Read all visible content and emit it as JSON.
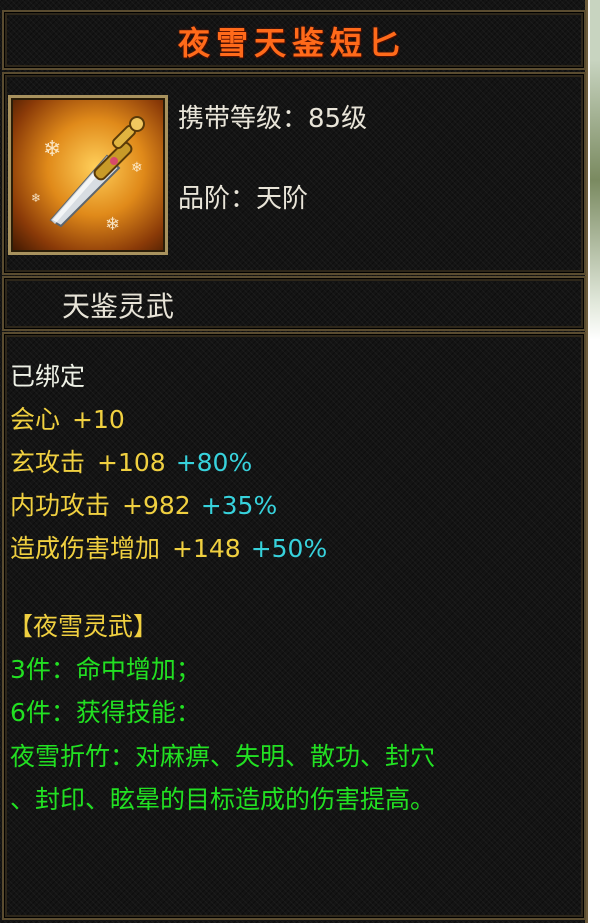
{
  "item": {
    "name": "夜雪天鉴短匕",
    "level_line": "携带等级：85级",
    "grade_line": "品阶：天阶",
    "category": "天鉴灵武",
    "icon": "dagger-icon"
  },
  "stats": {
    "bound": "已绑定",
    "crit": {
      "label": "会心",
      "value": "+10"
    },
    "xuan_attack": {
      "label": "玄攻击",
      "value": "+108",
      "bonus": "+80%"
    },
    "inner_attack": {
      "label": "内功攻击",
      "value": "+982",
      "bonus": "+35%"
    },
    "damage_increase": {
      "label": "造成伤害增加",
      "value": "+148",
      "bonus": "+50%"
    }
  },
  "set": {
    "name": "【夜雪灵武】",
    "bonus3": "3件：命中增加；",
    "bonus6": "6件：获得技能：",
    "skill_line1": "夜雪折竹：对麻痹、失明、散功、封穴",
    "skill_line2": "、封印、眩晕的目标造成的伤害提高。"
  },
  "colors": {
    "title": "#ff6a1a",
    "stat_label": "#f0d040",
    "bonus": "#37d2dc",
    "set_effect": "#22e022",
    "frame": "#5a4c30"
  }
}
